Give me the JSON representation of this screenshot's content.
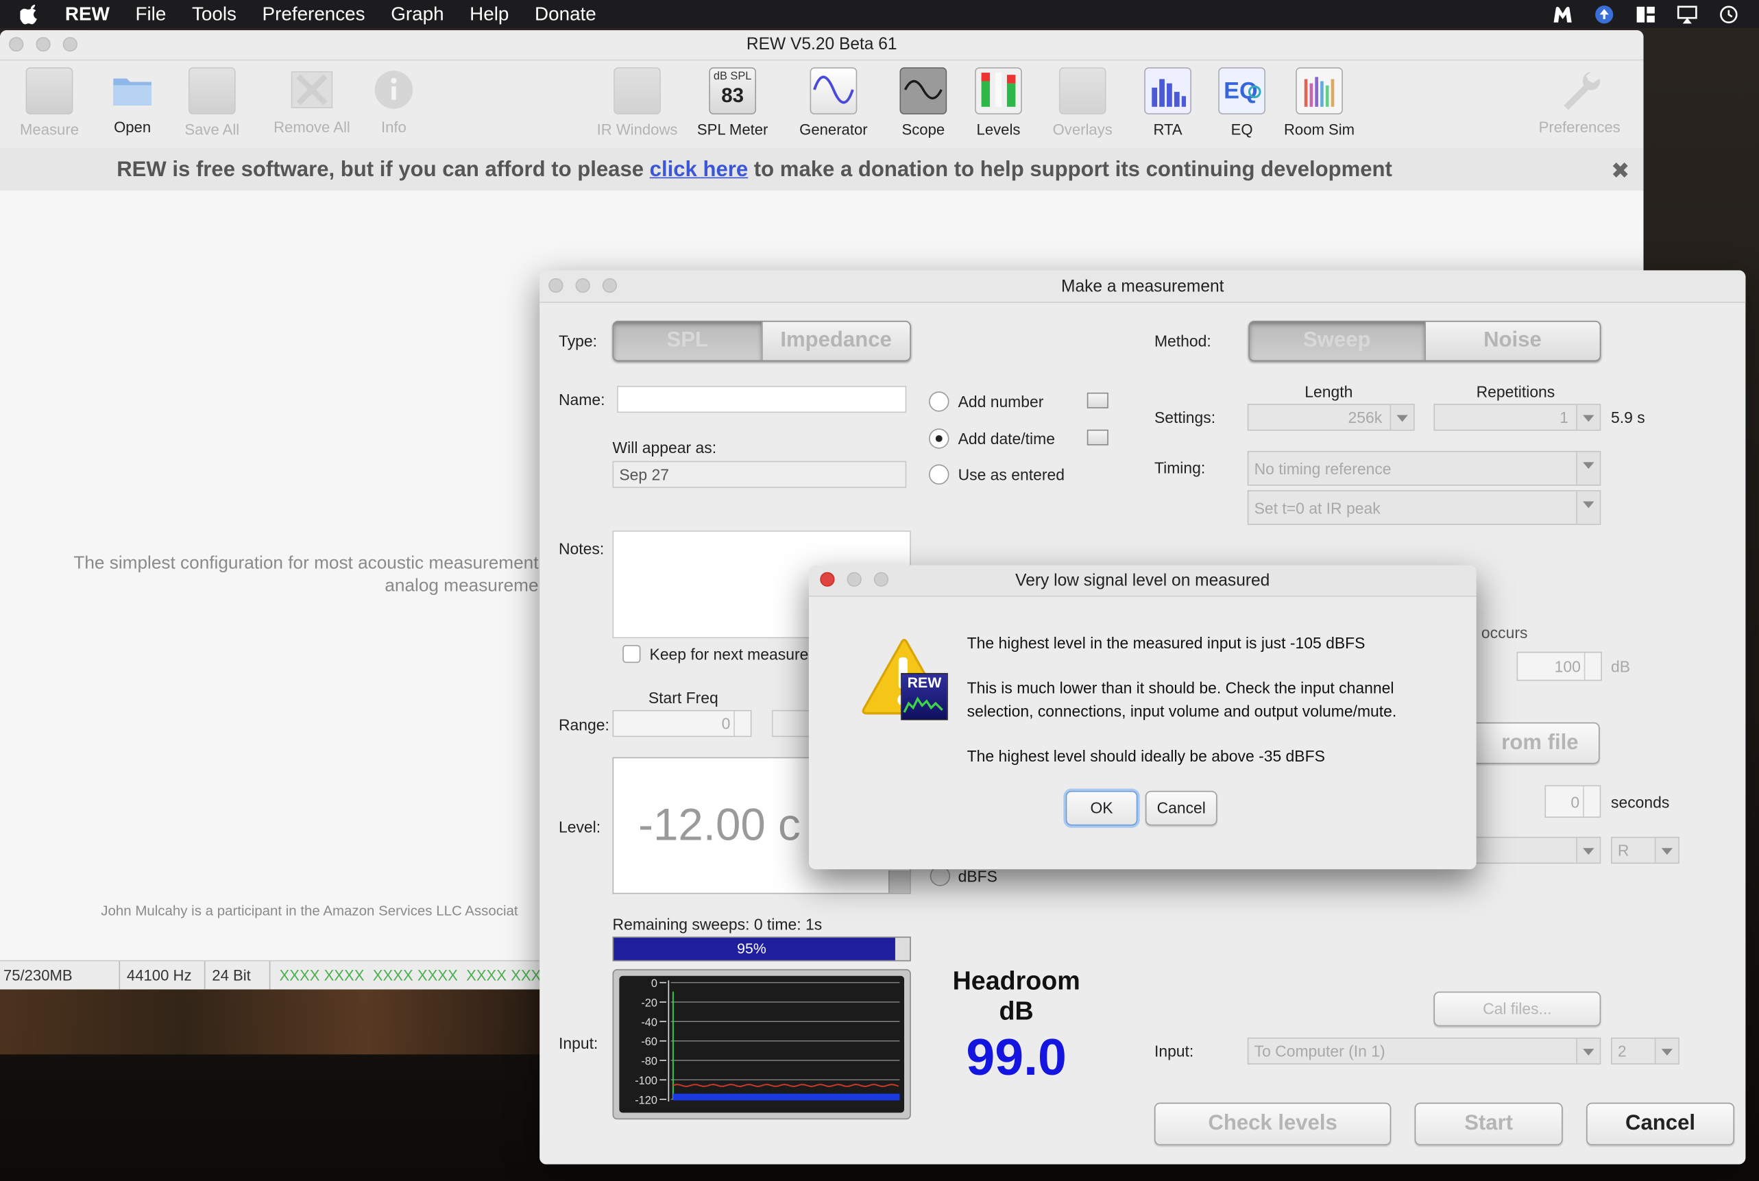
{
  "menubar": {
    "items": [
      "REW",
      "File",
      "Tools",
      "Preferences",
      "Graph",
      "Help",
      "Donate"
    ]
  },
  "mainwin": {
    "title": "REW V5.20 Beta 61",
    "toolbar": [
      {
        "label": "Measure",
        "enabled": false
      },
      {
        "label": "Open",
        "enabled": true
      },
      {
        "label": "Save All",
        "enabled": false
      },
      {
        "label": "Remove All",
        "enabled": false
      },
      {
        "label": "Info",
        "enabled": false
      },
      {
        "label": "IR Windows",
        "enabled": false
      },
      {
        "label": "SPL Meter",
        "enabled": true
      },
      {
        "label": "Generator",
        "enabled": true
      },
      {
        "label": "Scope",
        "enabled": true
      },
      {
        "label": "Levels",
        "enabled": true
      },
      {
        "label": "Overlays",
        "enabled": false
      },
      {
        "label": "RTA",
        "enabled": true
      },
      {
        "label": "EQ",
        "enabled": true
      },
      {
        "label": "Room Sim",
        "enabled": true
      },
      {
        "label": "Preferences",
        "enabled": false
      }
    ],
    "spl_icon_top": "dB SPL",
    "spl_icon_value": "83",
    "donate_pre": "REW is free software, but if you can afford to please",
    "donate_link": "click here",
    "donate_post": "to make a donation to help support its continuing development",
    "faint_line1": "The simplest configuration for most acoustic measurement",
    "faint_line2": "analog measureme",
    "amazon_text": "John Mulcahy is a participant in the Amazon Services LLC Associat",
    "status": {
      "memory": "75/230MB",
      "rate": "44100 Hz",
      "bits": "24 Bit",
      "channels": "XXXX XXXX  XXXX XXXX  XXXX XXXX"
    }
  },
  "measure_dialog": {
    "title": "Make a measurement",
    "type_label": "Type:",
    "type_options": [
      "SPL",
      "Impedance"
    ],
    "name_label": "Name:",
    "name_value": "",
    "appear_label": "Will appear as:",
    "appear_value": "Sep 27",
    "radio_add_number": "Add number",
    "radio_add_datetime": "Add date/time",
    "radio_use_entered": "Use as entered",
    "notes_label": "Notes:",
    "keep_label": "Keep for next measure",
    "start_freq_label": "Start Freq",
    "range_label": "Range:",
    "range_start": "0",
    "level_label": "Level:",
    "level_value": "-12.00 c",
    "remaining_label": "Remaining sweeps: 0   time: 1s",
    "progress_text": "95%",
    "progress_fraction": 0.95,
    "input_label": "Input:",
    "meter_ticks": [
      "0",
      "-20",
      "-40",
      "-60",
      "-80",
      "-100",
      "-120"
    ],
    "headroom_title": "Headroom",
    "headroom_unit": "dB",
    "headroom_value": "99.0",
    "dbfs_label": "dBFS",
    "method_label": "Method:",
    "method_options": [
      "Sweep",
      "Noise"
    ],
    "length_label": "Length",
    "repetitions_label": "Repetitions",
    "settings_label": "Settings:",
    "length_value": "256k",
    "repetitions_value": "1",
    "duration_text": "5.9 s",
    "timing_label": "Timing:",
    "timing_ref": "No timing reference",
    "timing_t0": "Set t=0 at IR peak",
    "clip_label_partial": "ng occurs",
    "clip_value": "100",
    "clip_unit": "dB",
    "from_file_partial": "rom file",
    "seconds_value": "0",
    "seconds_label": "seconds",
    "output_ch": "R",
    "cal_files": "Cal files...",
    "input_label_right": "Input:",
    "input_device": "To Computer (In 1)",
    "input_channel": "2",
    "btn_check": "Check levels",
    "btn_start": "Start",
    "btn_cancel": "Cancel"
  },
  "alert": {
    "title": "Very low signal level on measured",
    "line1": "The highest level in the measured input is just -105 dBFS",
    "line2": "This is much lower than it should be. Check the input channel",
    "line3": "selection, connections, input volume and output volume/mute.",
    "line4": "The highest level should ideally be above -35 dBFS",
    "icon_badge": "REW",
    "ok": "OK",
    "cancel": "Cancel"
  }
}
